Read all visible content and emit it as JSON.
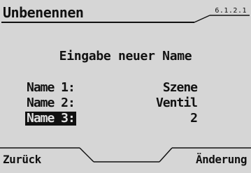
{
  "screen": {
    "title": "Unbenennen",
    "menu_code": "6.1.2.1",
    "heading": "Eingabe neuer Name"
  },
  "fields": [
    {
      "label": "Name 1:",
      "value": "Szene",
      "selected": false
    },
    {
      "label": "Name 2:",
      "value": "Ventil",
      "selected": false
    },
    {
      "label": "Name 3:",
      "value": "2",
      "selected": true
    }
  ],
  "softkeys": {
    "left": "Zurück",
    "right": "Änderung"
  }
}
